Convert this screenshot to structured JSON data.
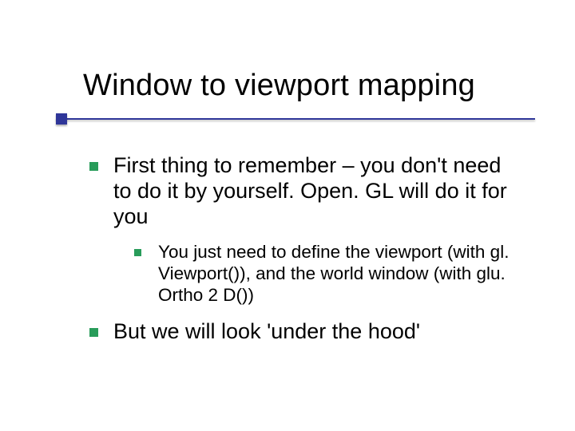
{
  "title": "Window to viewport mapping",
  "bullets": {
    "b1": "First thing to remember – you don't need to do it by yourself. Open. GL will do it for you",
    "b1_1": "You just need to define the viewport (with gl. Viewport()), and the world window (with glu. Ortho 2 D())",
    "b2": "But we will look 'under the hood'"
  }
}
